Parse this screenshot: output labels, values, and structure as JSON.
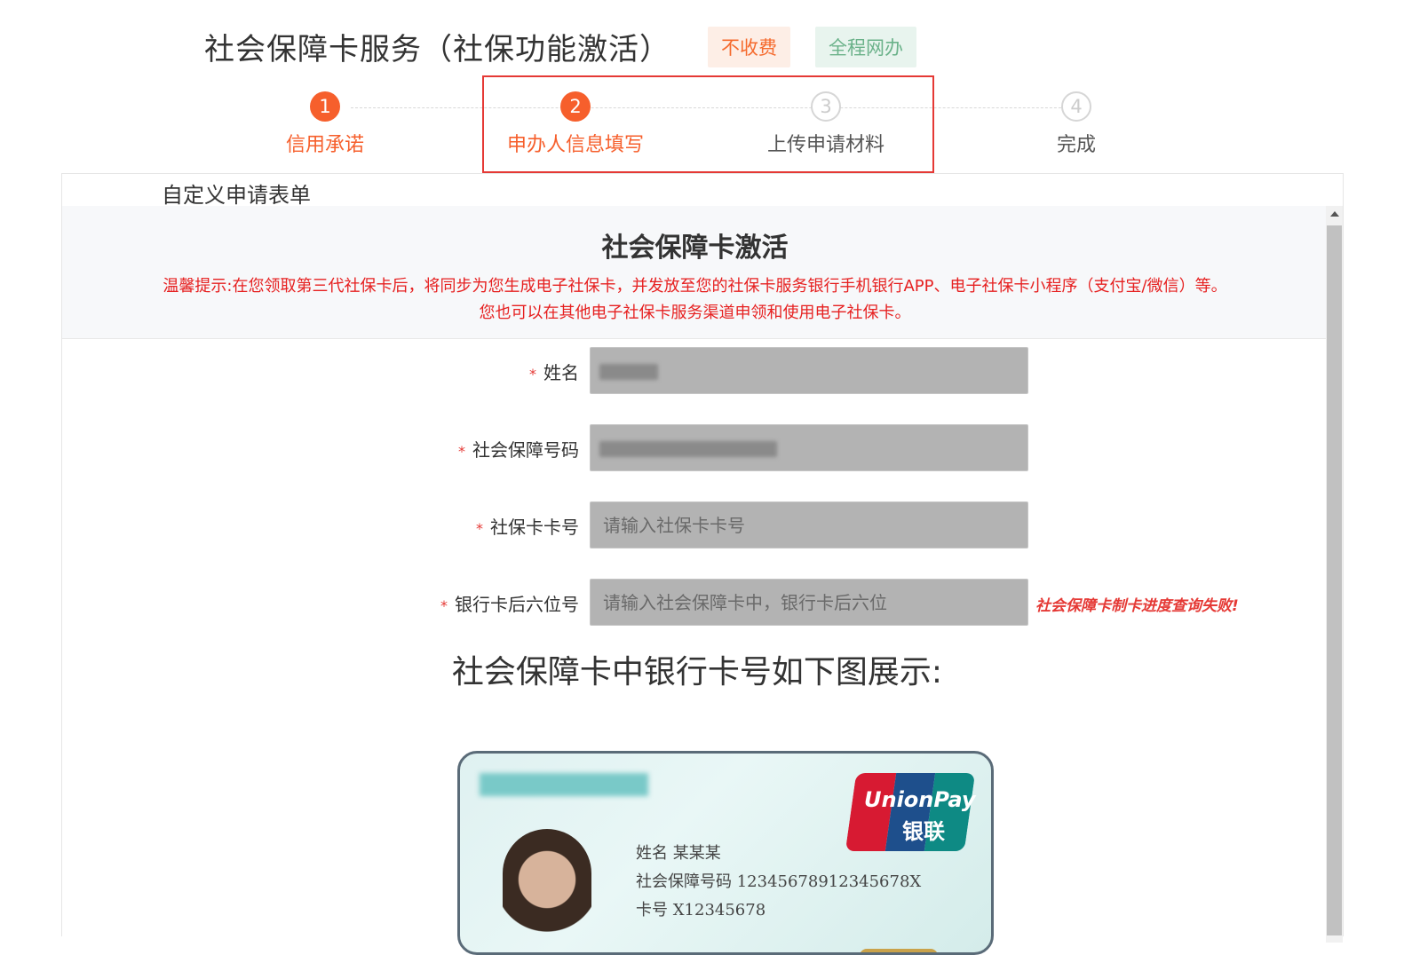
{
  "header": {
    "title": "社会保障卡服务（社保功能激活）",
    "badge_fee": "不收费",
    "badge_online": "全程网办"
  },
  "steps": [
    {
      "number": "1",
      "label": "信用承诺",
      "state": "active"
    },
    {
      "number": "2",
      "label": "申办人信息填写",
      "state": "active"
    },
    {
      "number": "3",
      "label": "上传申请材料",
      "state": "inactive"
    },
    {
      "number": "4",
      "label": "完成",
      "state": "inactive"
    }
  ],
  "panel": {
    "tab": "自定义申请表单",
    "notice_title": "社会保障卡激活",
    "notice_tip_line1": "温馨提示:在您领取第三代社保卡后，将同步为您生成电子社保卡，并发放至您的社保卡服务银行手机银行APP、电子社保卡小程序（支付宝/微信）等。",
    "notice_tip_line2": "您也可以在其他电子社保卡服务渠道申领和使用电子社保卡。"
  },
  "form": {
    "required_mark": "*",
    "name_label": "姓名",
    "ssn_label": "社会保障号码",
    "card_no_label": "社保卡卡号",
    "card_no_placeholder": "请输入社保卡卡号",
    "bank_label": "银行卡后六位号",
    "bank_placeholder": "请输入社会保障卡中，银行卡后六位",
    "bank_error": "社会保障卡制卡进度查询失败!"
  },
  "card_section": {
    "heading": "社会保障卡中银行卡号如下图展示:",
    "unionpay_en": "UnionPay",
    "unionpay_cn": "银联",
    "line_name": "姓名   某某某",
    "line_ssn": "社会保障号码  1234567891234567​8X",
    "line_card": "卡号  X12345678"
  },
  "colors": {
    "accent": "#f65f2c",
    "error": "#e53935",
    "input_bg": "#b3b3b3"
  }
}
